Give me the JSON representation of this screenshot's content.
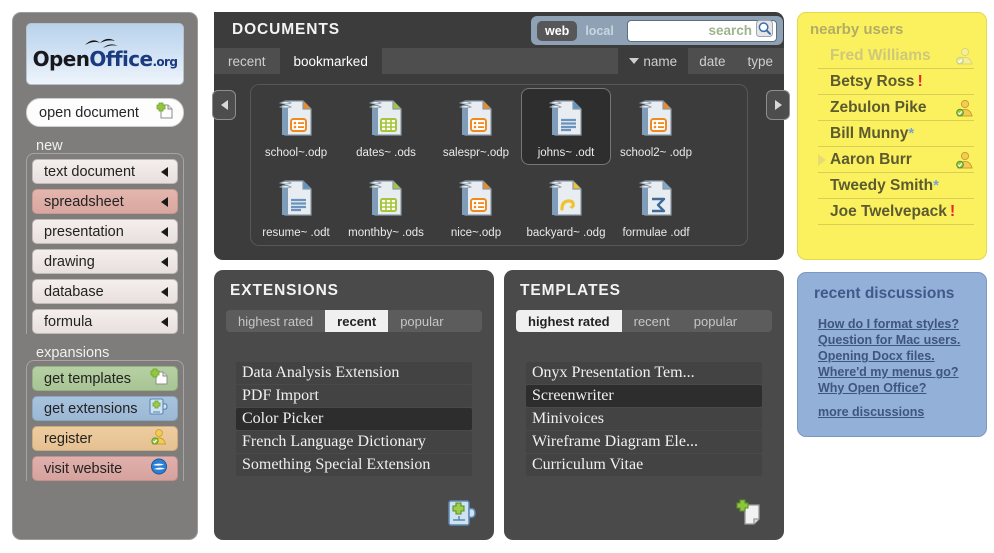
{
  "sidebar": {
    "logo": {
      "part1": "Open",
      "part2": "Office",
      "part3": ".org",
      "icon": "seagulls-icon"
    },
    "open_document_label": "open document",
    "open_document_icon": "new-document-icon",
    "new_group_label": "new",
    "new_items": [
      {
        "label": "text document",
        "state": "normal"
      },
      {
        "label": "spreadsheet",
        "state": "selected"
      },
      {
        "label": "presentation",
        "state": "normal"
      },
      {
        "label": "drawing",
        "state": "normal"
      },
      {
        "label": "database",
        "state": "normal"
      },
      {
        "label": "formula",
        "state": "normal"
      }
    ],
    "expansions_group_label": "expansions",
    "expansion_items": [
      {
        "label": "get templates",
        "icon": "new-template-icon",
        "color": "#b6d0a3"
      },
      {
        "label": "get extensions",
        "icon": "puzzle-piece-icon",
        "color": "#a8c3dd"
      },
      {
        "label": "register",
        "icon": "user-check-icon",
        "color": "#edcc9e"
      },
      {
        "label": "visit website",
        "icon": "globe-icon",
        "color": "#e0b0ac"
      }
    ]
  },
  "documents": {
    "title": "DOCUMENTS",
    "tabs": [
      {
        "label": "recent",
        "active": false
      },
      {
        "label": "bookmarked",
        "active": true
      }
    ],
    "sort": [
      {
        "label": "name",
        "active": true,
        "caret": true
      },
      {
        "label": "date",
        "active": false,
        "caret": false
      },
      {
        "label": "type",
        "active": false,
        "caret": false
      }
    ],
    "prev_arrow": "arrow-left-icon",
    "next_arrow": "arrow-right-icon",
    "files": [
      {
        "label": "school~.odp",
        "type": "odp",
        "selected": false
      },
      {
        "label": "dates~ .ods",
        "type": "ods",
        "selected": false
      },
      {
        "label": "salespr~.odp",
        "type": "odp",
        "selected": false
      },
      {
        "label": "johns~ .odt",
        "type": "odt",
        "selected": true
      },
      {
        "label": "school2~ .odp",
        "type": "odp",
        "selected": false
      },
      {
        "label": "resume~ .odt",
        "type": "odt",
        "selected": false
      },
      {
        "label": "monthby~ .ods",
        "type": "ods",
        "selected": false
      },
      {
        "label": "nice~.odp",
        "type": "odp",
        "selected": false
      },
      {
        "label": "backyard~ .odg",
        "type": "odg",
        "selected": false
      },
      {
        "label": "formulae .odf",
        "type": "odf",
        "selected": false
      }
    ]
  },
  "search": {
    "scope_web": "web",
    "scope_local": "local",
    "active_scope": "web",
    "value": "",
    "placeholder": "search",
    "icon": "magnifier-icon"
  },
  "extensions": {
    "title": "EXTENSIONS",
    "tabs": [
      {
        "label": "highest rated",
        "active": false
      },
      {
        "label": "recent",
        "active": true
      },
      {
        "label": "popular",
        "active": false
      }
    ],
    "items": [
      {
        "label": "Data Analysis Extension",
        "highlighted": false
      },
      {
        "label": "PDF Import",
        "highlighted": false
      },
      {
        "label": "Color Picker",
        "highlighted": true
      },
      {
        "label": "French Language Dictionary",
        "highlighted": false
      },
      {
        "label": "Something Special Extension",
        "highlighted": false
      }
    ],
    "corner_icon": "add-extension-icon"
  },
  "templates": {
    "title": "TEMPLATES",
    "tabs": [
      {
        "label": "highest rated",
        "active": true
      },
      {
        "label": "recent",
        "active": false
      },
      {
        "label": "popular",
        "active": false
      }
    ],
    "items": [
      {
        "label": "Onyx Presentation Tem...",
        "highlighted": false
      },
      {
        "label": "Screenwriter",
        "highlighted": true
      },
      {
        "label": "Minivoices",
        "highlighted": false
      },
      {
        "label": "Wireframe Diagram Ele...",
        "highlighted": false
      },
      {
        "label": "Curriculum Vitae",
        "highlighted": false
      }
    ],
    "corner_icon": "add-template-icon"
  },
  "nearby_users": {
    "title": "nearby users",
    "users": [
      {
        "name": "Fred Williams",
        "dim": true,
        "badge": "",
        "icon": "user-offline-icon",
        "caret": false
      },
      {
        "name": "Betsy Ross",
        "dim": false,
        "badge": "!",
        "icon": "",
        "caret": false
      },
      {
        "name": "Zebulon Pike",
        "dim": false,
        "badge": "",
        "icon": "user-check-icon",
        "caret": false
      },
      {
        "name": "Bill Munny",
        "dim": false,
        "badge": "*",
        "icon": "",
        "caret": false
      },
      {
        "name": "Aaron Burr",
        "dim": false,
        "badge": "",
        "icon": "user-check-icon",
        "caret": true
      },
      {
        "name": "Tweedy Smith",
        "dim": false,
        "badge": "*",
        "icon": "",
        "caret": false
      },
      {
        "name": "Joe Twelvepack",
        "dim": false,
        "badge": "!",
        "icon": "",
        "caret": false
      }
    ]
  },
  "discussions": {
    "title": "recent discussions",
    "links": [
      "How do I format styles?",
      "Question for Mac users.",
      "Opening Docx files.",
      "Where'd my menus go?",
      "Why Open Office?"
    ],
    "more_label": "more discussions"
  },
  "colors": {
    "panel_dark": "#3c3c3c",
    "sidebar_gray": "#7e7d7b",
    "nearby_yellow": "#fbf15f",
    "discussions_blue": "#93b0d8",
    "search_blue": "#8fa2b5",
    "selected_red": "#e3b6ae"
  }
}
